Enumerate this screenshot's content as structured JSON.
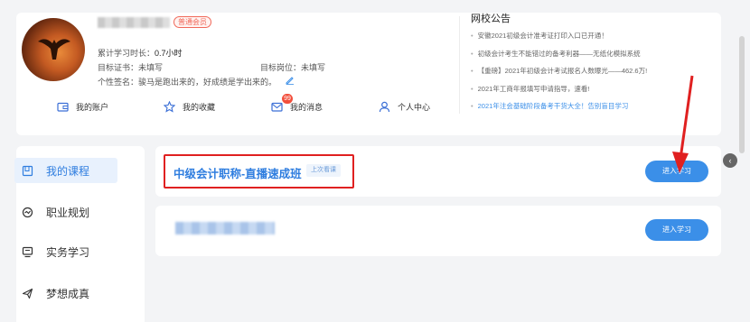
{
  "profile": {
    "vip_badge": "普通会员",
    "study_time_label": "累计学习时长：",
    "study_time_value": "0.7小时",
    "target_cert_label": "目标证书：",
    "target_cert_value": "未填写",
    "target_post_label": "目标岗位：",
    "target_post_value": "未填写",
    "signature_label": "个性签名：",
    "signature_value": "骏马是跑出来的，好成绩是学出来的。"
  },
  "quick_links": [
    {
      "label": "我的账户",
      "icon": "wallet-icon"
    },
    {
      "label": "我的收藏",
      "icon": "star-icon"
    },
    {
      "label": "我的消息",
      "icon": "mail-icon",
      "badge": "99"
    },
    {
      "label": "个人中心",
      "icon": "user-icon"
    }
  ],
  "notice": {
    "title": "网校公告",
    "items": [
      "安徽2021初级会计准考证打印入口已开通！",
      "初级会计考生不能错过的备考利器——无纸化模拟系统",
      "【重磅】2021年初级会计考试报名人数曝光——462.6万!",
      "2021年工商年报填写申请指导，速看!",
      "2021年注会基础阶段备考干货大全！告别盲目学习"
    ]
  },
  "sidebar": {
    "items": [
      {
        "label": "我的课程",
        "icon": "book-icon"
      },
      {
        "label": "职业规划",
        "icon": "compass-icon"
      },
      {
        "label": "实务学习",
        "icon": "monitor-icon"
      },
      {
        "label": "梦想成真",
        "icon": "plane-icon"
      }
    ]
  },
  "courses": [
    {
      "title": "中级会计职称-直播速成班",
      "tag": "上次看课",
      "button": "进入学习"
    },
    {
      "button": "进入学习"
    }
  ],
  "colors": {
    "accent": "#3b8fe8",
    "highlight_red": "#e02020",
    "badge_red": "#f24f3c"
  }
}
